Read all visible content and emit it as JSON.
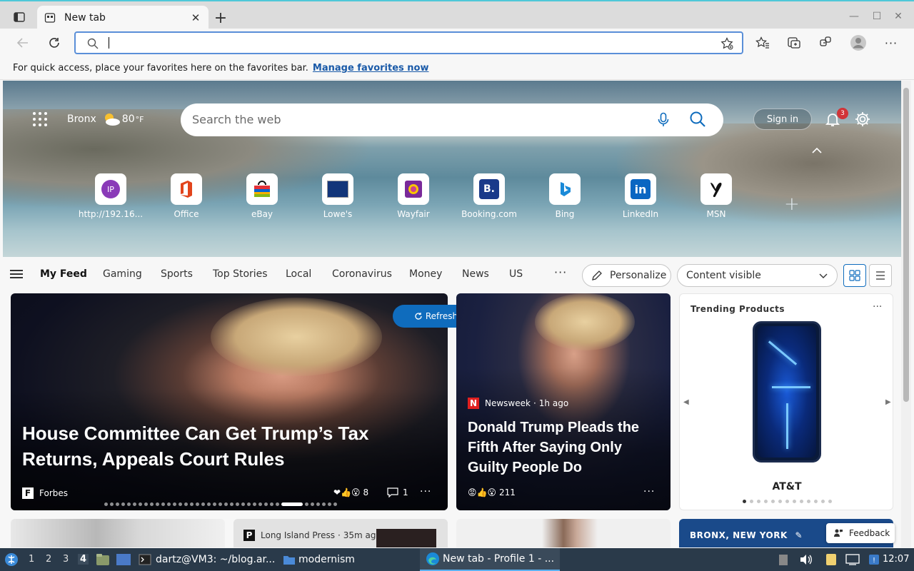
{
  "browser": {
    "tab_title": "New tab",
    "favorites_prompt": "For quick access, place your favorites here on the favorites bar.",
    "manage_favorites": "Manage favorites now"
  },
  "hero": {
    "location": "Bronx",
    "temperature": "80",
    "temp_unit": "°F",
    "search_placeholder": "Search the web",
    "sign_in": "Sign in",
    "notification_count": "3"
  },
  "quick_links": [
    {
      "label": "http://192.16...",
      "icon": "ip-icon",
      "initials": "IP",
      "color": "#8a3ab8"
    },
    {
      "label": "Office",
      "icon": "office-icon",
      "color": "#e2441c"
    },
    {
      "label": "eBay",
      "icon": "ebay-icon",
      "color": "#1a6ad8"
    },
    {
      "label": "Lowe's",
      "icon": "lowes-icon",
      "color": "#12357a"
    },
    {
      "label": "Wayfair",
      "icon": "wayfair-icon",
      "color": "#7a2a9a"
    },
    {
      "label": "Booking.com",
      "icon": "booking-icon",
      "initials": "B.",
      "color": "#1a3a8a"
    },
    {
      "label": "Bing",
      "icon": "bing-icon",
      "color": "#1a8ad8"
    },
    {
      "label": "LinkedIn",
      "icon": "linkedin-icon",
      "initials": "in",
      "color": "#0a66c2"
    },
    {
      "label": "MSN",
      "icon": "msn-icon",
      "color": "#111111"
    }
  ],
  "feed_nav": {
    "items": [
      "My Feed",
      "Gaming",
      "Sports",
      "Top Stories",
      "Local",
      "Coronavirus",
      "Money",
      "News",
      "US"
    ],
    "personalize": "Personalize",
    "content_visibility": "Content visible"
  },
  "cards": {
    "main": {
      "headline": "House Committee Can Get Trump’s Tax Returns, Appeals Court Rules",
      "source": "Forbes",
      "source_logo": "F",
      "reactions": "8",
      "comments": "1"
    },
    "refresh": "Refresh stories",
    "second": {
      "source": "Newsweek",
      "time": "1h ago",
      "source_logo": "N",
      "headline": "Donald Trump Pleads the Fifth After Saying Only Guilty People Do",
      "reactions": "211"
    },
    "trending": {
      "title": "Trending Products",
      "carrier": "AT&T"
    },
    "row2": {
      "source": "Long Island Press",
      "time": "35m ag",
      "location": "BRONX, NEW YORK"
    },
    "feedback": "Feedback"
  },
  "taskbar": {
    "workspaces": [
      "1",
      "2",
      "3",
      "4"
    ],
    "terminal": "dartz@VM3: ~/blog.ar...",
    "folder": "modernism",
    "browser": "New tab - Profile 1 - ...",
    "time": "12:07"
  }
}
